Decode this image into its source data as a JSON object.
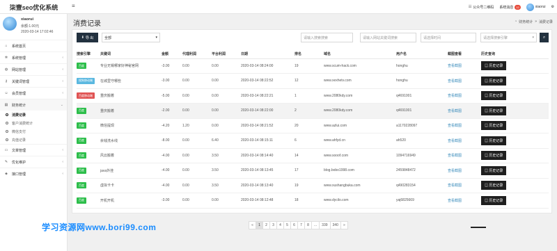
{
  "header": {
    "site_title": "柒壹seo优化系统",
    "menu_icon": "hamburger-icon",
    "qr_label": "公众号二维码",
    "messages_label": "系统消息",
    "messages_count": "12",
    "username": "xiaorui"
  },
  "sidebar": {
    "user": {
      "name": "xiaorui",
      "balance": "余额:1.00元",
      "time": "2020-03-14 17:02:46"
    },
    "items": [
      {
        "label": "系统首页",
        "icon": "home-icon"
      },
      {
        "label": "系统管理",
        "icon": "gear-icon"
      },
      {
        "label": "网站管理",
        "icon": "globe-icon"
      },
      {
        "label": "关键词管理",
        "icon": "key-icon"
      },
      {
        "label": "会员管理",
        "icon": "user-icon"
      },
      {
        "label": "财务统计",
        "icon": "chart-icon"
      },
      {
        "label": "文章管理",
        "icon": "doc-icon"
      },
      {
        "label": "优化维护",
        "icon": "wrench-icon"
      },
      {
        "label": "接口管理",
        "icon": "plug-icon"
      }
    ],
    "subitems": [
      {
        "label": "消费记录"
      },
      {
        "label": "客户消费统计"
      },
      {
        "label": "微信支付"
      },
      {
        "label": "充值记录"
      }
    ]
  },
  "page": {
    "title": "消费记录",
    "crumb_home": "财务统计",
    "crumb_sep": "»",
    "crumb_current": "消费记录"
  },
  "filters": {
    "export_label": "导 出",
    "all_option": "全部",
    "ph_keyword": "请输入搜索搜索",
    "ph_url": "请输入网站关键词搜索",
    "ph_time": "请选择时间",
    "ph_engine": "请选择搜索引擎"
  },
  "table": {
    "headers": [
      "搜索引擎",
      "关键词",
      "金额",
      "代理利润",
      "平台利润",
      "日期",
      "排名",
      "域名",
      "用户名",
      "截图查看",
      "历史查询"
    ],
    "rows": [
      {
        "engine": "百度",
        "engine_color": "#2dbe4b",
        "keyword": "专业无锡哪家好神秘官网",
        "amount": "-3.00",
        "agent": "0.00",
        "platform": "0.00",
        "date": "2020-03-14 08:24:00",
        "rank": "19",
        "domain": "www.scum-hack.com",
        "user": "honghu",
        "shot": "查看截图",
        "hist": "历史记录"
      },
      {
        "engine": "搜狗移动端",
        "engine_color": "#5bb8e0",
        "keyword": "在城里守哪些",
        "amount": "-3.00",
        "agent": "0.00",
        "platform": "0.00",
        "date": "2020-03-14 08:22:52",
        "rank": "12",
        "domain": "www.xexhetv.com",
        "user": "honghu",
        "shot": "查看截图",
        "hist": "历史记录"
      },
      {
        "engine": "百度移动端",
        "engine_color": "#e05353",
        "keyword": "重庆搬着",
        "amount": "-5.00",
        "agent": "0.00",
        "platform": "0.00",
        "date": "2020-03-14 08:22:21",
        "rank": "1",
        "domain": "www.2080kdy.com",
        "user": "q4691001",
        "shot": "查看截图",
        "hist": "历史记录"
      },
      {
        "engine": "百度",
        "engine_color": "#2dbe4b",
        "keyword": "重庆搬着",
        "amount": "-2.00",
        "agent": "0.00",
        "platform": "0.00",
        "date": "2020-03-14 08:22:00",
        "rank": "2",
        "domain": "www.2080kdy.com",
        "user": "q4691001",
        "shot": "查看截图",
        "hist": "历史记录"
      },
      {
        "engine": "百度",
        "engine_color": "#2dbe4b",
        "keyword": "微信提现",
        "amount": "-4.20",
        "agent": "1.20",
        "platform": "0.00",
        "date": "2020-03-14 08:21:52",
        "rank": "20",
        "domain": "www.azlui.com",
        "user": "a1170228097",
        "shot": "查看截图",
        "hist": "历史记录"
      },
      {
        "engine": "百度",
        "engine_color": "#2dbe4b",
        "keyword": "余钱洗水线",
        "amount": "-8.00",
        "agent": "0.00",
        "platform": "6.40",
        "date": "2020-03-14 08:15:11",
        "rank": "6",
        "domain": "www.ahfyd.cn",
        "user": "ah520",
        "shot": "查看截图",
        "hist": "历史记录"
      },
      {
        "engine": "百度",
        "engine_color": "#2dbe4b",
        "keyword": "风云搬着",
        "amount": "-4.00",
        "agent": "0.00",
        "platform": "3.50",
        "date": "2020-03-14 08:14:40",
        "rank": "14",
        "domain": "www.sooof.com",
        "user": "1094716949",
        "shot": "查看截图",
        "hist": "历史记录"
      },
      {
        "engine": "百度",
        "engine_color": "#2dbe4b",
        "keyword": "java外挂",
        "amount": "-4.00",
        "agent": "0.00",
        "platform": "3.50",
        "date": "2020-03-14 08:13:45",
        "rank": "17",
        "domain": "blog.bobo1998.com",
        "user": "2459848472",
        "shot": "查看截图",
        "hist": "历史记录"
      },
      {
        "engine": "百度",
        "engine_color": "#2dbe4b",
        "keyword": "虚拟卡卡",
        "amount": "-4.00",
        "agent": "0.00",
        "platform": "3.50",
        "date": "2020-03-14 08:13:40",
        "rank": "19",
        "domain": "www.xushangbuka.com",
        "user": "q490283154",
        "shot": "查看截图",
        "hist": "历史记录"
      },
      {
        "engine": "百度",
        "engine_color": "#2dbe4b",
        "keyword": "开机开机",
        "amount": "-3.00",
        "agent": "0.00",
        "platform": "0.00",
        "date": "2020-03-14 08:12:48",
        "rank": "18",
        "domain": "www.dycilo.com",
        "user": "yaj6825669",
        "shot": "查看截图",
        "hist": "历史记录"
      }
    ]
  },
  "pagination": [
    "«",
    "1",
    "2",
    "3",
    "4",
    "5",
    "6",
    "7",
    "8",
    "...",
    "339",
    "340",
    "»"
  ],
  "watermark": "学习资源网www.bori99.com"
}
